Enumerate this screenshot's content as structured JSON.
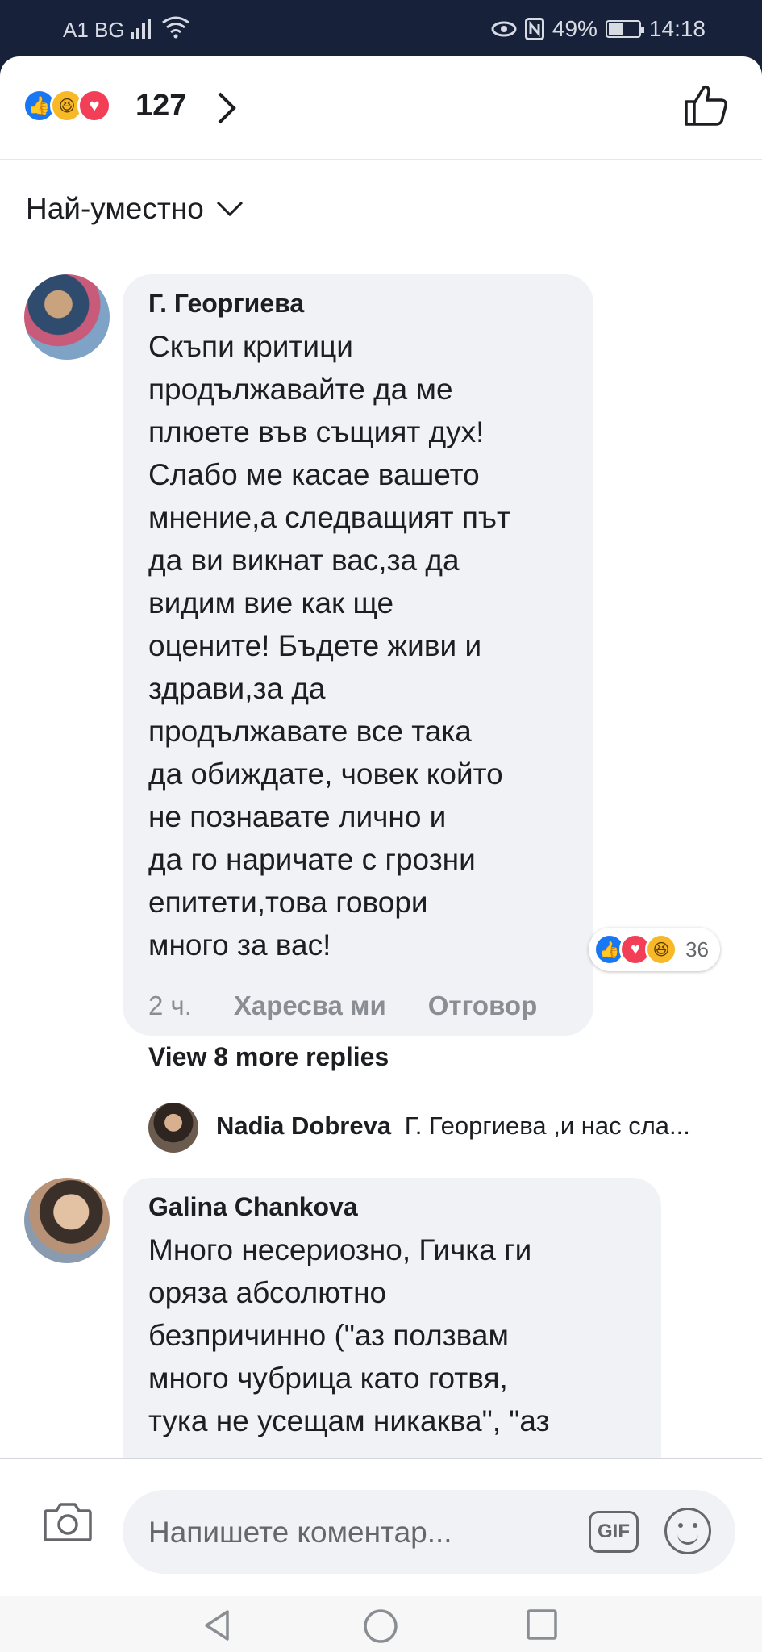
{
  "status_bar": {
    "carrier": "A1 BG",
    "battery": "49%",
    "time": "14:18"
  },
  "reactions": {
    "count": "127",
    "icons": [
      "like-icon",
      "haha-icon",
      "love-icon"
    ]
  },
  "sort": {
    "label": "Най-уместно"
  },
  "comments": [
    {
      "author": "Г. Георгиева",
      "text": "Скъпи критици\nпродължавайте да ме\nплюете във  същият дух!\nСлабо ме касае вашето\nмнение,а следващият път\nда ви викнат вас,за да\nвидим вие как ще\nоцените! Бъдете живи и\nздрави,за да\nпродължавате все така\nда обиждате, човек който\nне познавате лично и\nда го наричате с грозни\nепитети,това говори\nмного за вас!",
      "reaction_count": "36",
      "time": "2 ч.",
      "like_label": "Харесва ми",
      "reply_label": "Отговор",
      "more_replies": "View 8 more replies",
      "reply_preview": {
        "author": "Nadia Dobreva",
        "text": "Г. Георгиева ,и нас сла..."
      }
    },
    {
      "author": "Galina Chankova",
      "text": "Много несериозно, Гичка ги\nоряза абсолютно\nбезпричинно (\"аз ползвам\nмного чубрица като готвя,\nтука не усещам никаква\", \"аз"
    }
  ],
  "composer": {
    "placeholder": "Напишете коментар...",
    "gif_label": "GIF"
  }
}
